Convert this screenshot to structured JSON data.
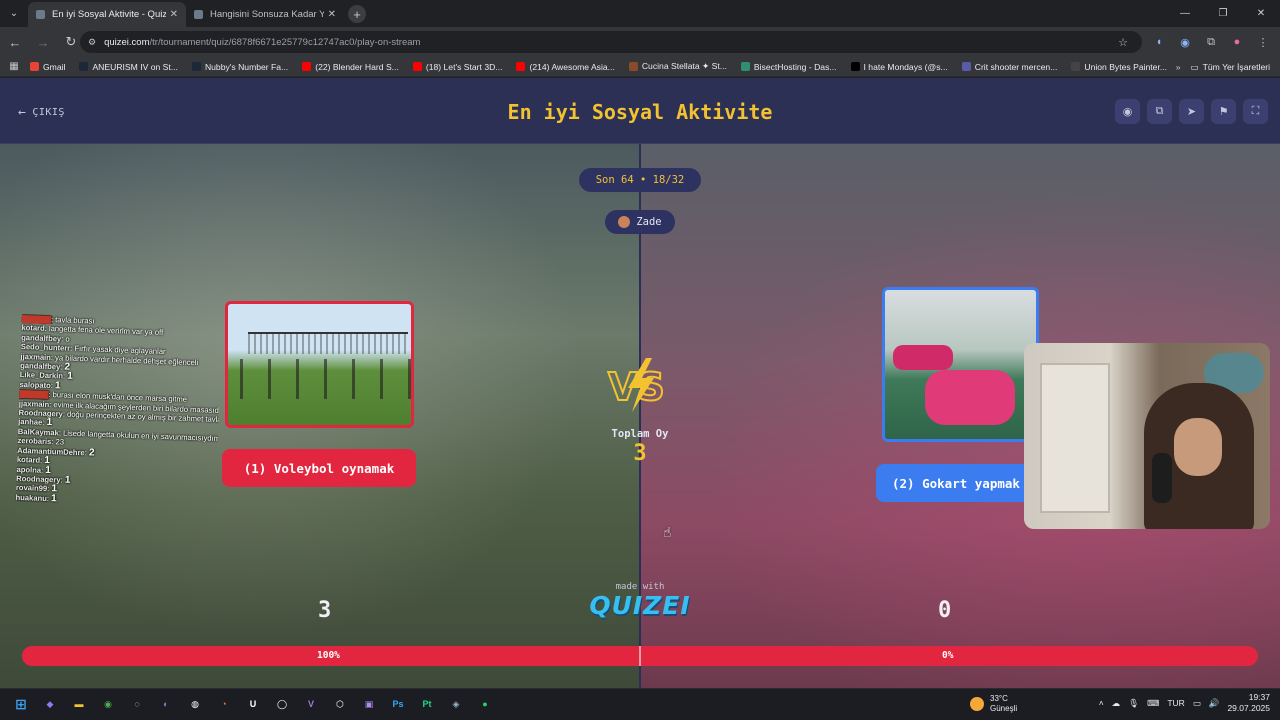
{
  "browser": {
    "tabs": [
      {
        "label": "En iyi Sosyal Aktivite - Quizei",
        "active": true
      },
      {
        "label": "Hangisini Sonsuza Kadar Yasakl",
        "active": false
      }
    ],
    "url_host": "quizei.com",
    "url_path": "/tr/tournament/quiz/6878f6671e25779c12747ac0/play-on-stream",
    "bookmarks": [
      {
        "label": "Gmail",
        "color": "#ea4335"
      },
      {
        "label": "ANEURISM IV on St...",
        "color": "#1b2838"
      },
      {
        "label": "Nubby's Number Fa...",
        "color": "#1b2838"
      },
      {
        "label": "(22) Blender Hard S...",
        "color": "#ff0000"
      },
      {
        "label": "(18) Let's Start 3D...",
        "color": "#ff0000"
      },
      {
        "label": "(214) Awesome Asia...",
        "color": "#ff0000"
      },
      {
        "label": "Cucina Stellata ✦ St...",
        "color": "#8a4b2a"
      },
      {
        "label": "BisectHosting - Das...",
        "color": "#2f8f6f"
      },
      {
        "label": "I hate Mondays (@s...",
        "color": "#000000"
      },
      {
        "label": "Crit shooter mercen...",
        "color": "#5a5aaa"
      },
      {
        "label": "Union Bytes Painter...",
        "color": "#444444"
      }
    ],
    "bookmarks_folder": "Tüm Yer İşaretleri"
  },
  "quiz": {
    "exit_label": "ÇIKIŞ",
    "title": "En iyi Sosyal Aktivite",
    "stage": "Son 64 • 18/32",
    "player": "Zade",
    "left_option": "(1) Voleybol oynamak",
    "right_option": "(2) Gokart yapmak",
    "vs_label": "Toplam Oy",
    "total_votes": "3",
    "made_with": "made with",
    "logo_text": "QUIZEI",
    "left_score": "3",
    "right_score": "0",
    "left_percent": "100%",
    "right_percent": "0%",
    "left_fraction": 1.0
  },
  "chat": [
    {
      "user": "",
      "msg": "tavla burası",
      "redacted": true
    },
    {
      "user": "kotard",
      "msg": "langetta fena ole verirlm var ya off"
    },
    {
      "user": "gandalfbey",
      "msg": "o"
    },
    {
      "user": "Sedo_hunterr",
      "msg": "Fırfır yasak diye aglayanlar"
    },
    {
      "user": "jjaxmain",
      "msg": "ya bilardo vardır herhalde dehşet eğlenceli"
    },
    {
      "user": "gandalfbey",
      "msg": "2",
      "big": true
    },
    {
      "user": "Like_Darkin",
      "msg": "1",
      "big": true
    },
    {
      "user": "salopato",
      "msg": "1",
      "big": true
    },
    {
      "user": "",
      "msg": "burası elon musk'dan önce marsa gitme",
      "redacted": true
    },
    {
      "user": "jjaxmain",
      "msg": "evime ilk alacağım şeylerden biri bilardo masasıdır"
    },
    {
      "user": "Roodnagery",
      "msg": "doğu perinçekten az oy almış bir zahmet tavlaya basma ya"
    },
    {
      "user": "janhae",
      "msg": "1",
      "big": true
    },
    {
      "user": "BalKaymak",
      "msg": "Lisede langetta okulun en iyi savunmacısıydım"
    },
    {
      "user": "zerobaris",
      "msg": "23"
    },
    {
      "user": "AdamantiumDehre",
      "msg": "2",
      "big": true
    },
    {
      "user": "kotard",
      "msg": "1",
      "big": true
    },
    {
      "user": "apolna",
      "msg": "1",
      "big": true
    },
    {
      "user": "Roodnagery",
      "msg": "1",
      "big": true
    },
    {
      "user": "rovain99",
      "msg": "1",
      "big": true
    },
    {
      "user": "huakanu",
      "msg": "1",
      "big": true
    }
  ],
  "taskbar": {
    "weather_temp": "33°C",
    "weather_desc": "Güneşli",
    "language": "TUR",
    "time": "19:37",
    "date": "29.07.2025"
  },
  "colors": {
    "accent_yellow": "#f2c230",
    "left_red": "#e3263f",
    "right_blue": "#3b7cf0",
    "page_bg": "#2b2f57"
  }
}
